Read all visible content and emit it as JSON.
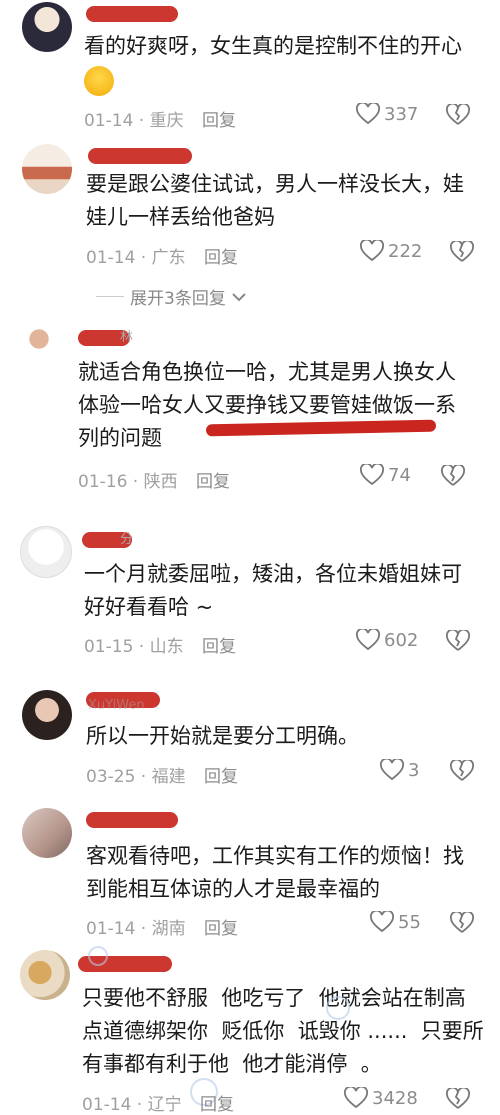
{
  "reply_label": "回复",
  "comments": [
    {
      "text": "看的好爽呀，女生真的是控制不住的开心",
      "date": "01-14",
      "location": "重庆",
      "likes": "337"
    },
    {
      "text": "要是跟公婆住试试，男人一样没长大，娃\n娃儿一样丢给他爸妈",
      "date": "01-14",
      "location": "广东",
      "likes": "222",
      "expand_label": "展开3条回复"
    },
    {
      "text": "就适合角色换位一哈，尤其是男人换女人\n体验一哈女人又要挣钱又要管娃做饭一系\n列的问题",
      "date": "01-16",
      "location": "陕西",
      "likes": "74"
    },
    {
      "text": "一个月就委屈啦，矮油，各位未婚姐妹可\n好好看看哈 ~",
      "date": "01-15",
      "location": "山东",
      "likes": "602"
    },
    {
      "text": "所以一开始就是要分工明确。",
      "date": "03-25",
      "location": "福建",
      "likes": "3"
    },
    {
      "text": "客观看待吧，工作其实有工作的烦恼！找\n到能相互体谅的人才是最幸福的",
      "date": "01-14",
      "location": "湖南",
      "likes": "55"
    },
    {
      "text": "只要他不舒服  他吃亏了  他就会站在制高\n点道德绑架你  贬低你  诋毁你 ......  只要所\n有事都有利于他  他才能消停  。",
      "date": "01-14",
      "location": "辽宁",
      "likes": "3428"
    }
  ],
  "visible_name_fragments": [
    "林",
    "分",
    "XuYiWen"
  ]
}
